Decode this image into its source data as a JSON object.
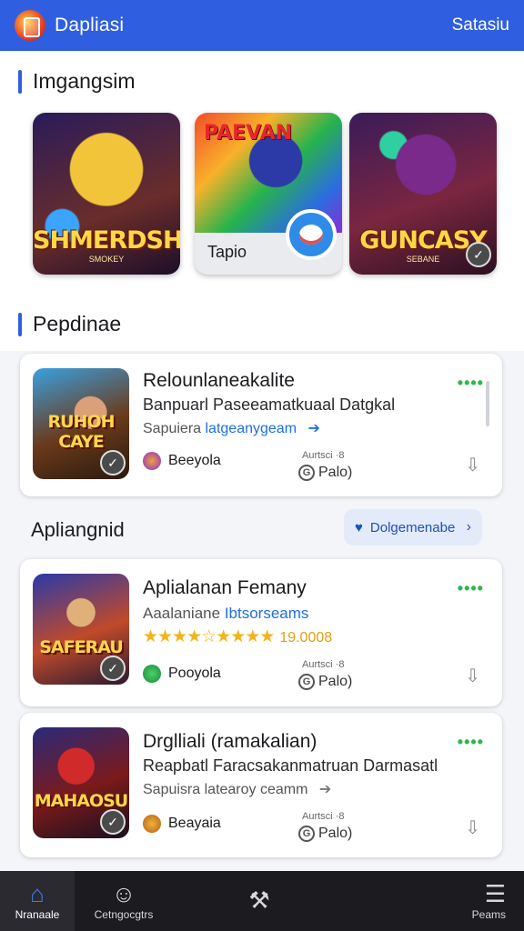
{
  "topbar": {
    "title": "Dapliasi",
    "action": "Satasiu",
    "accent": "#2f5fe0"
  },
  "sections": {
    "featured": "Imgangsim",
    "popular": "Pepdinae",
    "sub": "Apliangnid"
  },
  "featured": [
    {
      "word": "SHMERDSH",
      "sub": "SMOKEY"
    },
    {
      "top_word": "PAEVAN",
      "label": "Tapio"
    },
    {
      "word": "GUNCASY",
      "sub": "SEBANE"
    }
  ],
  "pill": {
    "label": "Dolgemenabe",
    "icon": "bird-icon"
  },
  "cards": [
    {
      "thumb_word": "RUHOH CAYE",
      "title": "Relounlaneakalite",
      "desc": "Banpuarl Paseeamatkuaal Datgkal",
      "meta_prefix": "Sapuiera",
      "meta_link": "latgeanygeam",
      "developer": "Beeyola",
      "rate_label": "Aurtsci ·8",
      "rate_value": "Palo)"
    },
    {
      "thumb_word": "SAFERAU",
      "title": "Aplialanan Femany",
      "desc_prefix": "Aaalaniane",
      "desc_link": "Ibtsorseams",
      "stars": "★★★★☆★★★★",
      "rating_num": "19.0008",
      "developer": "Pooyola",
      "rate_label": "Aurtsci ·8",
      "rate_value": "Palo)"
    },
    {
      "thumb_word": "MAHAOSU",
      "title": "Drglliali (ramakalian)",
      "desc": "Reapbatl Faracsakanmatruan Darmasatl",
      "meta_prefix": "Sapuisra",
      "meta_link": "latearoy ceamm",
      "developer": "Beayaia",
      "rate_label": "Aurtsci ·8",
      "rate_value": "Palo)"
    }
  ],
  "bottomnav": [
    {
      "label": "Nranaale",
      "icon": "home-icon",
      "glyph": "⌂"
    },
    {
      "label": "Cetngocgtrs",
      "icon": "people-icon",
      "glyph": "☺"
    },
    {
      "label": "",
      "icon": "wrench-icon",
      "glyph": "⚒"
    },
    {
      "label": "Peams",
      "icon": "menu-icon",
      "glyph": "☰"
    }
  ]
}
